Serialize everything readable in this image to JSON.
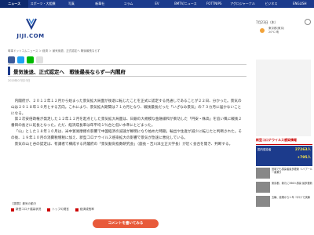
{
  "nav": {
    "tabs": [
      "ニュース",
      "スポーツ・大相撲",
      "写真",
      "新華社",
      "コラム",
      "EV",
      "BMTV/ニュース",
      "FOTTNIPS",
      "アグロジャーナル",
      "ビジネス",
      "ENGLISH"
    ]
  },
  "logo": {
    "text": "JIJI.COM",
    "brand_color": "#1c3b8c"
  },
  "header": {
    "date": "7月23日（木）",
    "weather_label": "東京都(東京)",
    "weather_detail": "20℃ 晴"
  },
  "breadcrumb": "時事ドットコムニュース ＞ 経済 ＞ 景気後退、正式認定へ 戦後最長ならず",
  "article": {
    "headline": "景気後退、正式認定へ　戦後最長ならず―内閣府",
    "timestamp": "2020年07月23日",
    "paragraphs": [
      "内閣府が、２０１２年１２月から始まった景気拡大局面が後退に転じたことを正式に認定する見通しであることが２２日、分かった。景気の山は２０１８年１０月とする方向。これにより、景気拡大期間は７１カ月となり、戦後最長だった「いざなみ景気」の７３カ月に届かないことになる。",
      "第２次安倍政権が発足した１２年１２月を起点とした景気拡大局面は、日銀の大規模な金融緩和が奏功した「円安・株高」を追い風に戦後２番目の長さに延長となった。ただ、経済成長率は年平均１％台と低い水準にとどまった。",
      "「山」とした１８年１０月は、米中貿易摩擦の影響で中国経済の減速が鮮明になり始めた時期。輸出や生産が減少に転じたと判断された。その後、１９年１０月の消費税増税に加え、新型コロナウイルス感染拡大の影響で景気が急速に悪化している。",
      "景気の山と谷の認定は、有識者で構成する内閣府の「景気動向指数研究会」（座長・吉川洋立正大学長）が近く会合を開き、判断する。"
    ],
    "caption": "【図表】景気の動き",
    "related": [
      "新型コロナ感染状況",
      "トップの発言",
      "経済成長率"
    ],
    "comment_button": "コメントを書いてみる"
  },
  "sidebar": {
    "section_title": "新型コロナウイルス感染情報",
    "covid_label": "国内感染者",
    "covid_count": "27263人",
    "covid_change": "+795人",
    "news": [
      "宮城でも感染者最多更新 リバプール一番乗り",
      "東京都、新たに366人感染 最多更新",
      "五輪、延期から１年 コロナで試練"
    ]
  }
}
